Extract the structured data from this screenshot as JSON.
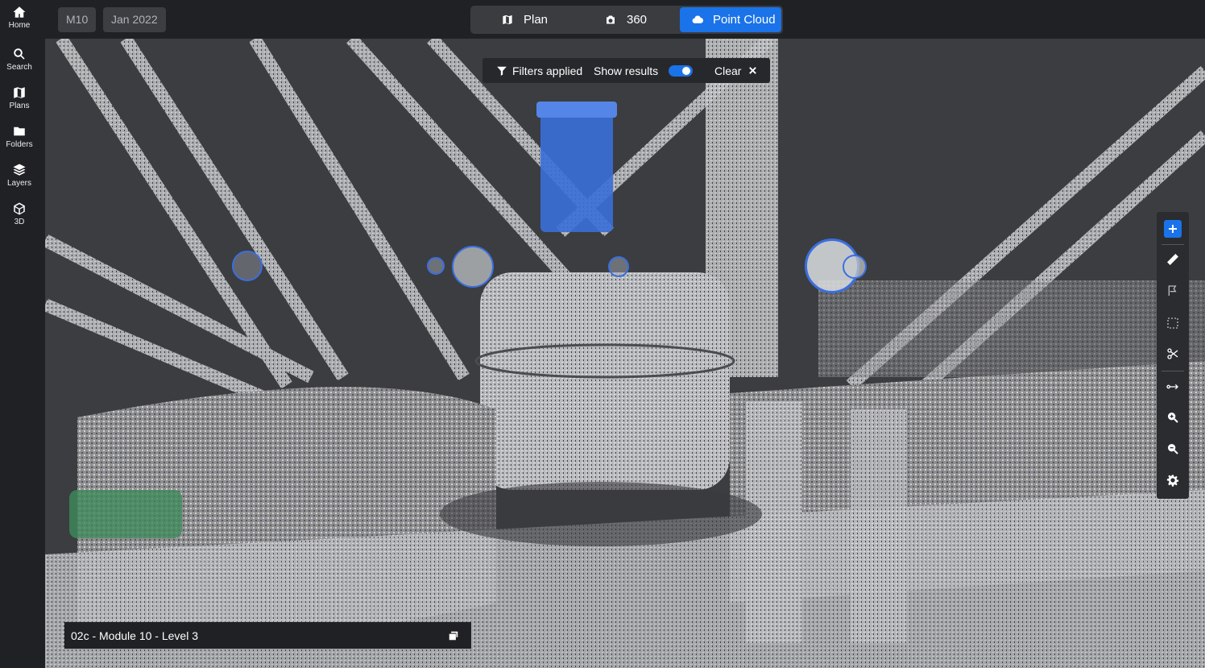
{
  "sidebar": {
    "items": [
      {
        "label": "Home",
        "icon": "home-icon"
      },
      {
        "label": "Search",
        "icon": "search-icon"
      },
      {
        "label": "Plans",
        "icon": "map-icon"
      },
      {
        "label": "Folders",
        "icon": "folder-icon"
      },
      {
        "label": "Layers",
        "icon": "layers-icon"
      },
      {
        "label": "3D",
        "icon": "cube-icon"
      }
    ]
  },
  "header": {
    "module_chip": "M10",
    "date_chip": "Jan 2022",
    "view_modes": [
      {
        "label": "Plan",
        "icon": "map-icon",
        "active": false
      },
      {
        "label": "360",
        "icon": "camera-icon",
        "active": false
      },
      {
        "label": "Point Cloud",
        "icon": "cloud-icon",
        "active": true
      }
    ]
  },
  "filters": {
    "status_label": "Filters applied",
    "show_results_label": "Show results",
    "show_results_on": true,
    "clear_label": "Clear"
  },
  "toolbar": {
    "tools": [
      "add-icon",
      "ruler-icon",
      "flag-icon",
      "selection-box-icon",
      "scissors-icon",
      "measure-line-icon",
      "zoom-in-icon",
      "zoom-out-icon",
      "settings-icon"
    ]
  },
  "location": {
    "label": "02c - Module 10 - Level 3"
  },
  "colors": {
    "accent": "#1a73e8",
    "background": "#202124",
    "scene_bg": "#3b3d40",
    "highlight_object": "#3a6fd8"
  }
}
